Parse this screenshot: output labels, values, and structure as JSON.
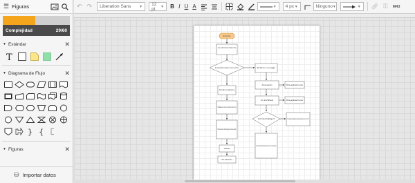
{
  "left_panel": {
    "title": "Figuras",
    "complexity": {
      "label": "Complejidad",
      "value_text": "29/60",
      "fraction": 0.483,
      "color": "#f4a51c"
    },
    "sections": {
      "standard": {
        "label": "Estándar"
      },
      "flowchart": {
        "label": "Diagrama de Flujo"
      },
      "shapes": {
        "label": "Figuras"
      }
    },
    "import_label": "Importar datos"
  },
  "toolbar": {
    "font": "Liberation Sans",
    "size": "12 pt",
    "bold": "B",
    "italic": "I",
    "underline": "U",
    "font_color": "A",
    "line_width": "4 px",
    "arrow_start": "Ninguno",
    "extra": "M43"
  },
  "flowchart": {
    "start": "Empezar",
    "n1": "Hola, nueabie buscar dos de Dias con Dios",
    "decision1": "Puede ayudar sin alguien a estos servicios",
    "right1": "Estaron en noggin",
    "n2": "Servidor a relaciones",
    "right2": "Armenación",
    "right2b": "Dña aplicarmento",
    "n3": "Trabajadores de Lunes a Viernes de 8am a 7pm",
    "right3": "LC de Pañuelo",
    "right3b": "Dña aplicarmento",
    "n4": "Pueblos distintivos en Calle Santiago de la de Colonia, Especifo",
    "decision2": "LC Del trabajo?",
    "right4b": "DR: puedes ayudarle los aspectos diversos de 1 a 3 de 17",
    "n5": "Llamar",
    "n6": "Sin Atención",
    "right5": "Podemos pudieron acceder hacia las pueblas de la zona del sur y con un cedar de 456 esque",
    "start_color": "#f8c98a"
  }
}
